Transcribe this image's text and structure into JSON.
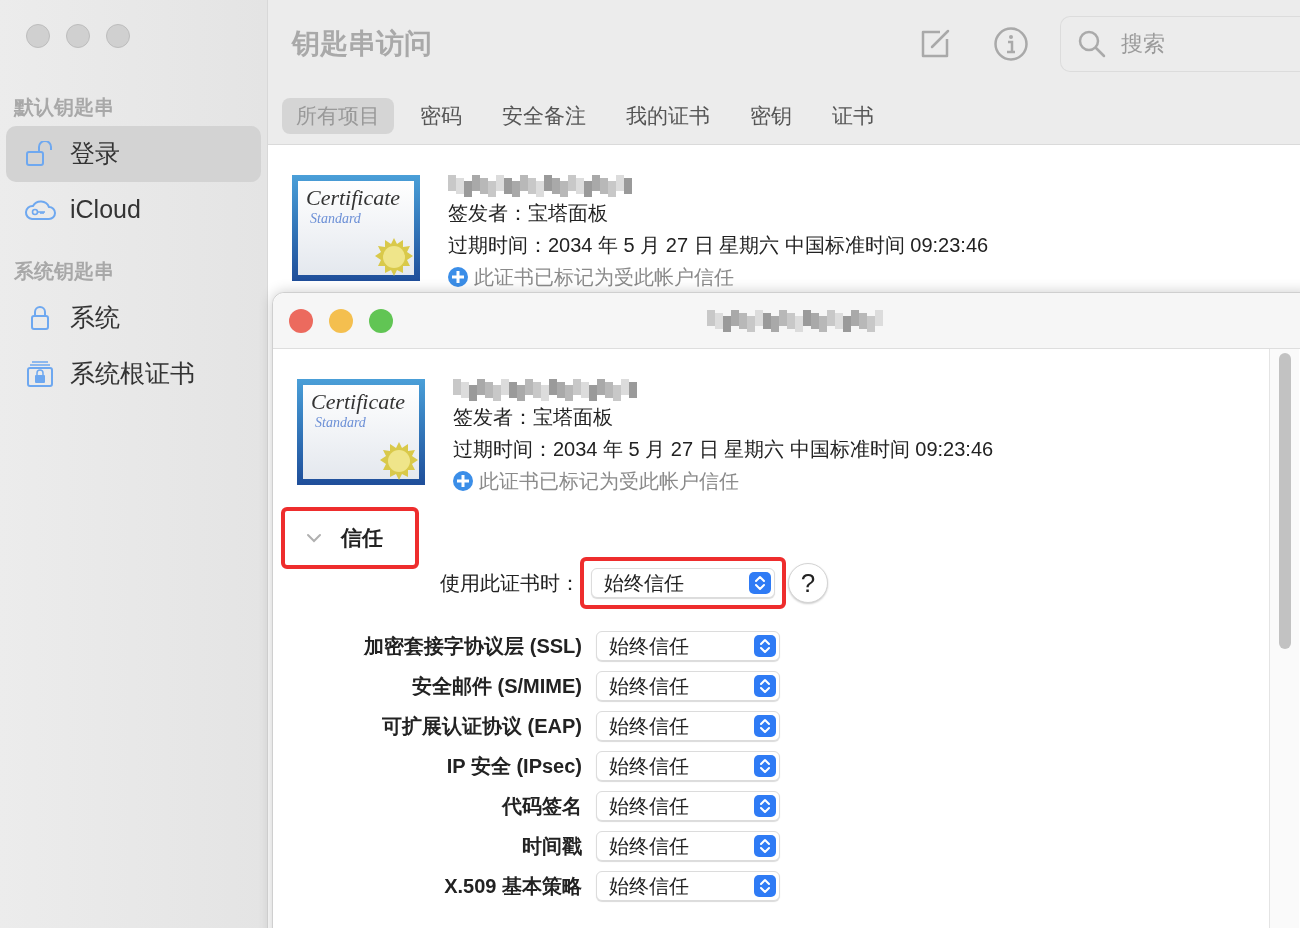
{
  "window": {
    "title": "钥匙串访问"
  },
  "toolbar": {
    "search": {
      "placeholder": "搜索"
    }
  },
  "sidebar": {
    "sections": [
      {
        "heading": "默认钥匙串",
        "items": [
          {
            "label": "登录",
            "selected": true,
            "kind": "unlocked"
          },
          {
            "label": "iCloud",
            "selected": false,
            "kind": "cloud"
          }
        ]
      },
      {
        "heading": "系统钥匙串",
        "items": [
          {
            "label": "系统",
            "selected": false,
            "kind": "lock"
          },
          {
            "label": "系统根证书",
            "selected": false,
            "kind": "cabinet"
          }
        ]
      }
    ]
  },
  "tabs": [
    {
      "label": "所有项目",
      "selected": true
    },
    {
      "label": "密码",
      "selected": false
    },
    {
      "label": "安全备注",
      "selected": false
    },
    {
      "label": "我的证书",
      "selected": false
    },
    {
      "label": "密钥",
      "selected": false
    },
    {
      "label": "证书",
      "selected": false
    }
  ],
  "list_item": {
    "icon": {
      "title": "Certificate",
      "subtitle": "Standard"
    },
    "issuer": "签发者：宝塔面板",
    "expires": "过期时间：2034 年 5 月 27 日 星期六 中国标准时间 09:23:46",
    "trust_note": "此证书已标记为受此帐户信任"
  },
  "detail_window": {
    "cert": {
      "icon": {
        "title": "Certificate",
        "subtitle": "Standard"
      },
      "issuer": "签发者：宝塔面板",
      "expires": "过期时间：2034 年 5 月 27 日 星期六 中国标准时间 09:23:46",
      "trust_note": "此证书已标记为受此帐户信任"
    },
    "trust_section": {
      "label": "信任",
      "expanded": true,
      "highlighted": true
    },
    "main_policy": {
      "label": "使用此证书时：",
      "value": "始终信任",
      "highlighted": true,
      "help": "?"
    },
    "policies": [
      {
        "label": "加密套接字协议层 (SSL)",
        "value": "始终信任"
      },
      {
        "label": "安全邮件 (S/MIME)",
        "value": "始终信任"
      },
      {
        "label": "可扩展认证协议 (EAP)",
        "value": "始终信任"
      },
      {
        "label": "IP 安全 (IPsec)",
        "value": "始终信任"
      },
      {
        "label": "代码签名",
        "value": "始终信任"
      },
      {
        "label": "时间戳",
        "value": "始终信任"
      },
      {
        "label": "X.509 基本策略",
        "value": "始终信任"
      }
    ]
  }
}
